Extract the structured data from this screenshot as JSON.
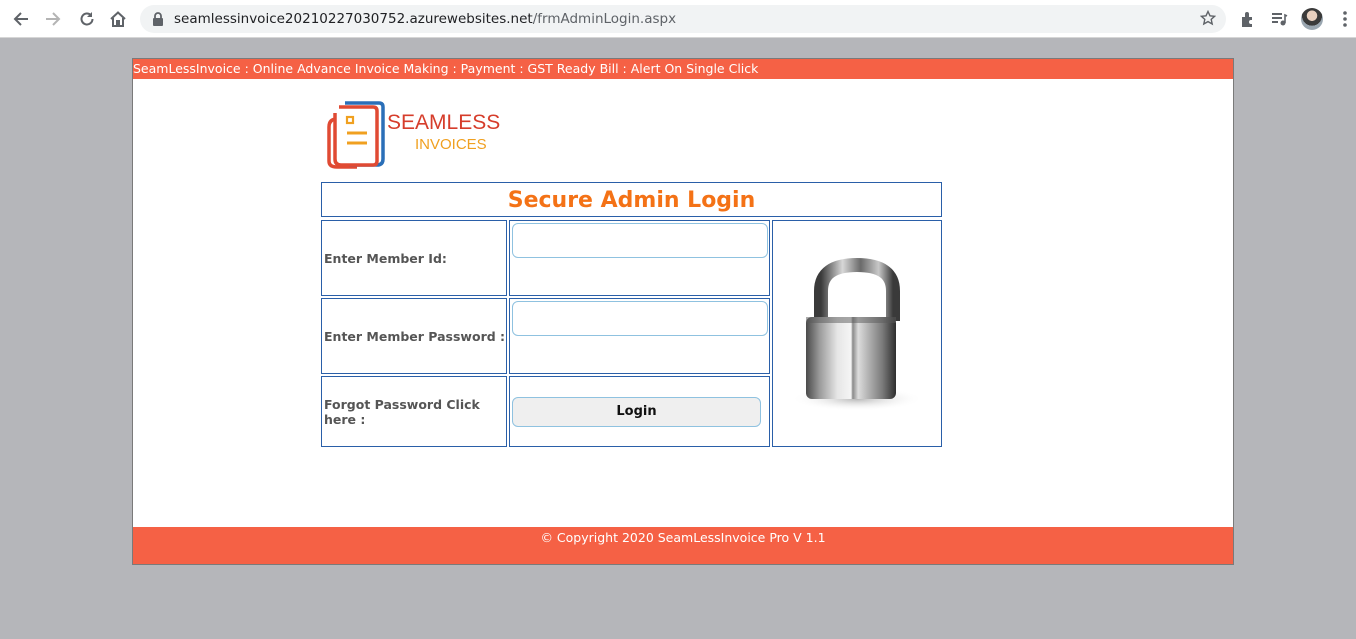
{
  "browser": {
    "url_host": "seamlessinvoice20210227030752.azurewebsites.net",
    "url_path": "/frmAdminLogin.aspx"
  },
  "header": {
    "tagline": "SeamLessInvoice : Online Advance Invoice Making : Payment : GST Ready Bill : Alert On Single Click"
  },
  "logo": {
    "line1": "SEAMLESS",
    "line2": "INVOICES"
  },
  "login": {
    "title": "Secure Admin Login",
    "member_id_label": "Enter Member Id:",
    "member_id_value": "",
    "password_label": "Enter Member Password :",
    "password_value": "",
    "forgot_label": "Forgot Password Click here :",
    "login_button": "Login"
  },
  "footer": {
    "copyright": "© Copyright 2020 SeamLessInvoice Pro V 1.1"
  },
  "colors": {
    "brand_bar": "#f56145",
    "title_orange": "#f47216",
    "border_blue": "#2a5fa8"
  },
  "icons": [
    "back-arrow-icon",
    "forward-arrow-icon",
    "reload-icon",
    "home-icon",
    "lock-icon",
    "star-icon",
    "extensions-icon",
    "media-icon",
    "menu-icon",
    "padlock-image"
  ]
}
